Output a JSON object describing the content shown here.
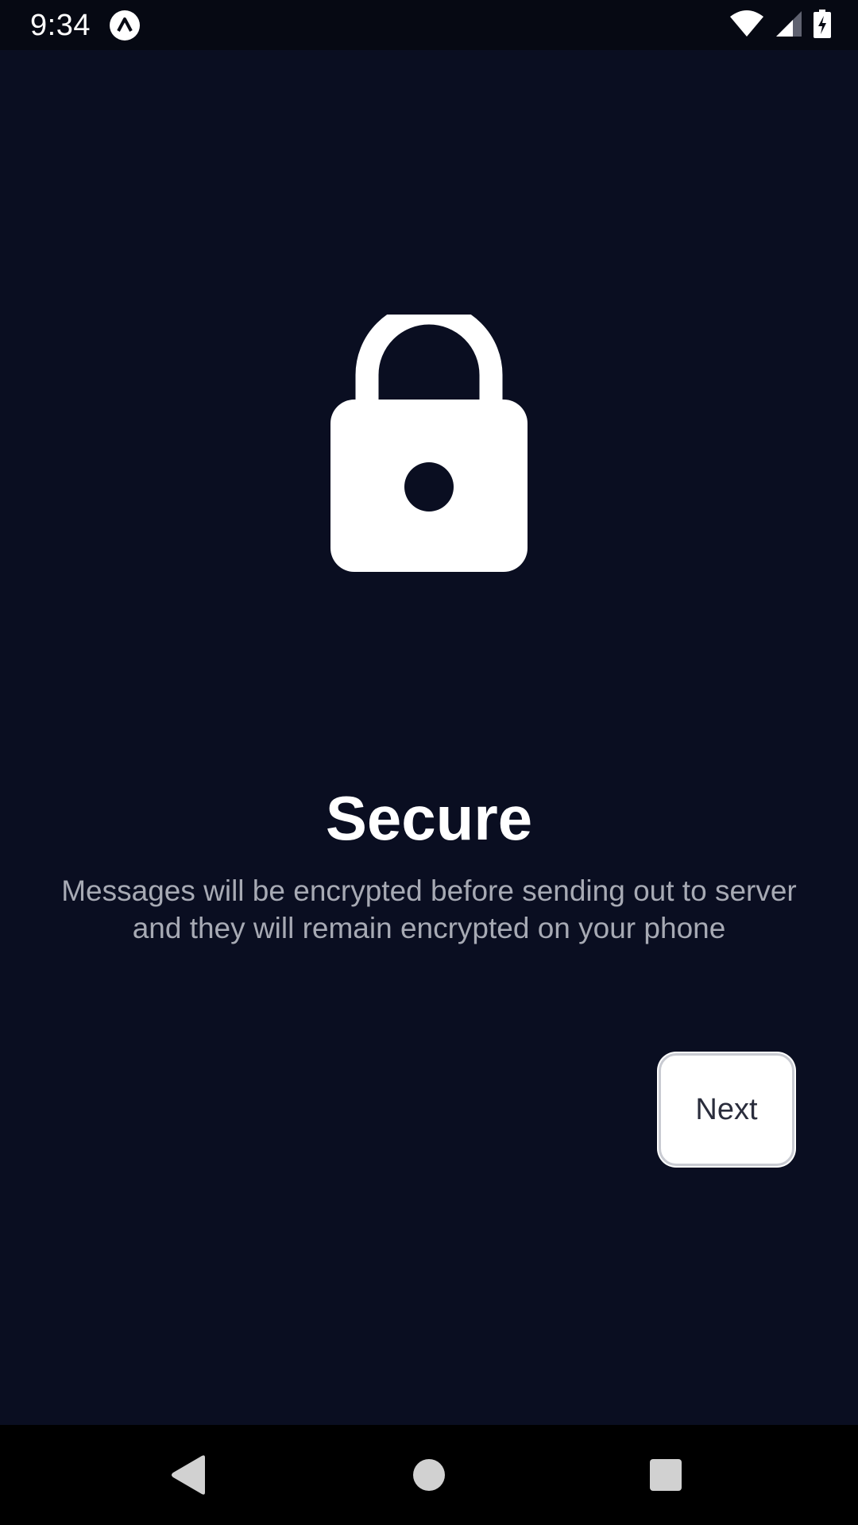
{
  "status_bar": {
    "time": "9:34",
    "icons": [
      "app-notification-icon",
      "wifi-icon",
      "cellular-signal-icon",
      "battery-charging-icon"
    ]
  },
  "onboarding": {
    "icon": "lock-icon",
    "title": "Secure",
    "description": "Messages will be encrypted before sending out to server and they will remain encrypted on your phone",
    "next_label": "Next"
  },
  "nav_bar": {
    "buttons": [
      "back-icon",
      "home-icon",
      "recents-icon"
    ]
  },
  "colors": {
    "background": "#0a0e21",
    "title": "#ffffff",
    "description": "#a7aab4",
    "button_bg": "#ffffff",
    "button_text": "#2a2d3c"
  }
}
